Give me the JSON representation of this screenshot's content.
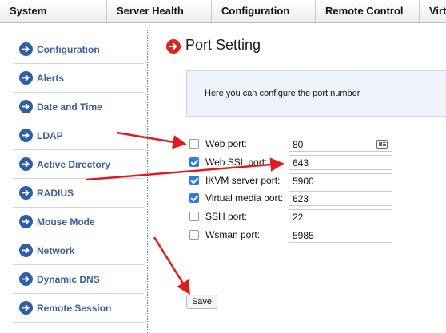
{
  "topnav": {
    "tabs": [
      {
        "label": "System",
        "w": 134
      },
      {
        "label": "Server Health",
        "w": 131
      },
      {
        "label": "Configuration",
        "w": 130
      },
      {
        "label": "Remote Control",
        "w": 130
      },
      {
        "label": "Virtu",
        "w": 33
      }
    ]
  },
  "sidebar": {
    "items": [
      {
        "label": "Configuration"
      },
      {
        "label": "Alerts"
      },
      {
        "label": "Date and Time"
      },
      {
        "label": "LDAP"
      },
      {
        "label": "Active Directory"
      },
      {
        "label": "RADIUS"
      },
      {
        "label": "Mouse Mode"
      },
      {
        "label": "Network"
      },
      {
        "label": "Dynamic DNS"
      },
      {
        "label": "Remote Session"
      }
    ]
  },
  "main": {
    "title": "Port Setting",
    "info": "Here you can configure the port number",
    "ports": [
      {
        "label": "Web port:",
        "checked": false,
        "value": "80"
      },
      {
        "label": "Web SSL port:",
        "checked": true,
        "value": "643"
      },
      {
        "label": "IKVM server port:",
        "checked": true,
        "value": "5900"
      },
      {
        "label": "Virtual media port:",
        "checked": true,
        "value": "623"
      },
      {
        "label": "SSH port:",
        "checked": false,
        "value": "22"
      },
      {
        "label": "Wsman port:",
        "checked": false,
        "value": "5985"
      }
    ],
    "save_label": "Save"
  },
  "colors": {
    "sidebar_text": "#3d5f96",
    "sidebar_icon": "#2f5ea7",
    "title_icon": "#d9281b",
    "checkbox_on": "#2e7ae6",
    "annotation_arrow": "#e01b1b",
    "info_bg": "#eef2fb"
  },
  "icons": {
    "sidebar_item": "arrow-circle-right-icon",
    "title": "arrow-circle-right-icon",
    "web_port_field": "contact-card-icon"
  }
}
